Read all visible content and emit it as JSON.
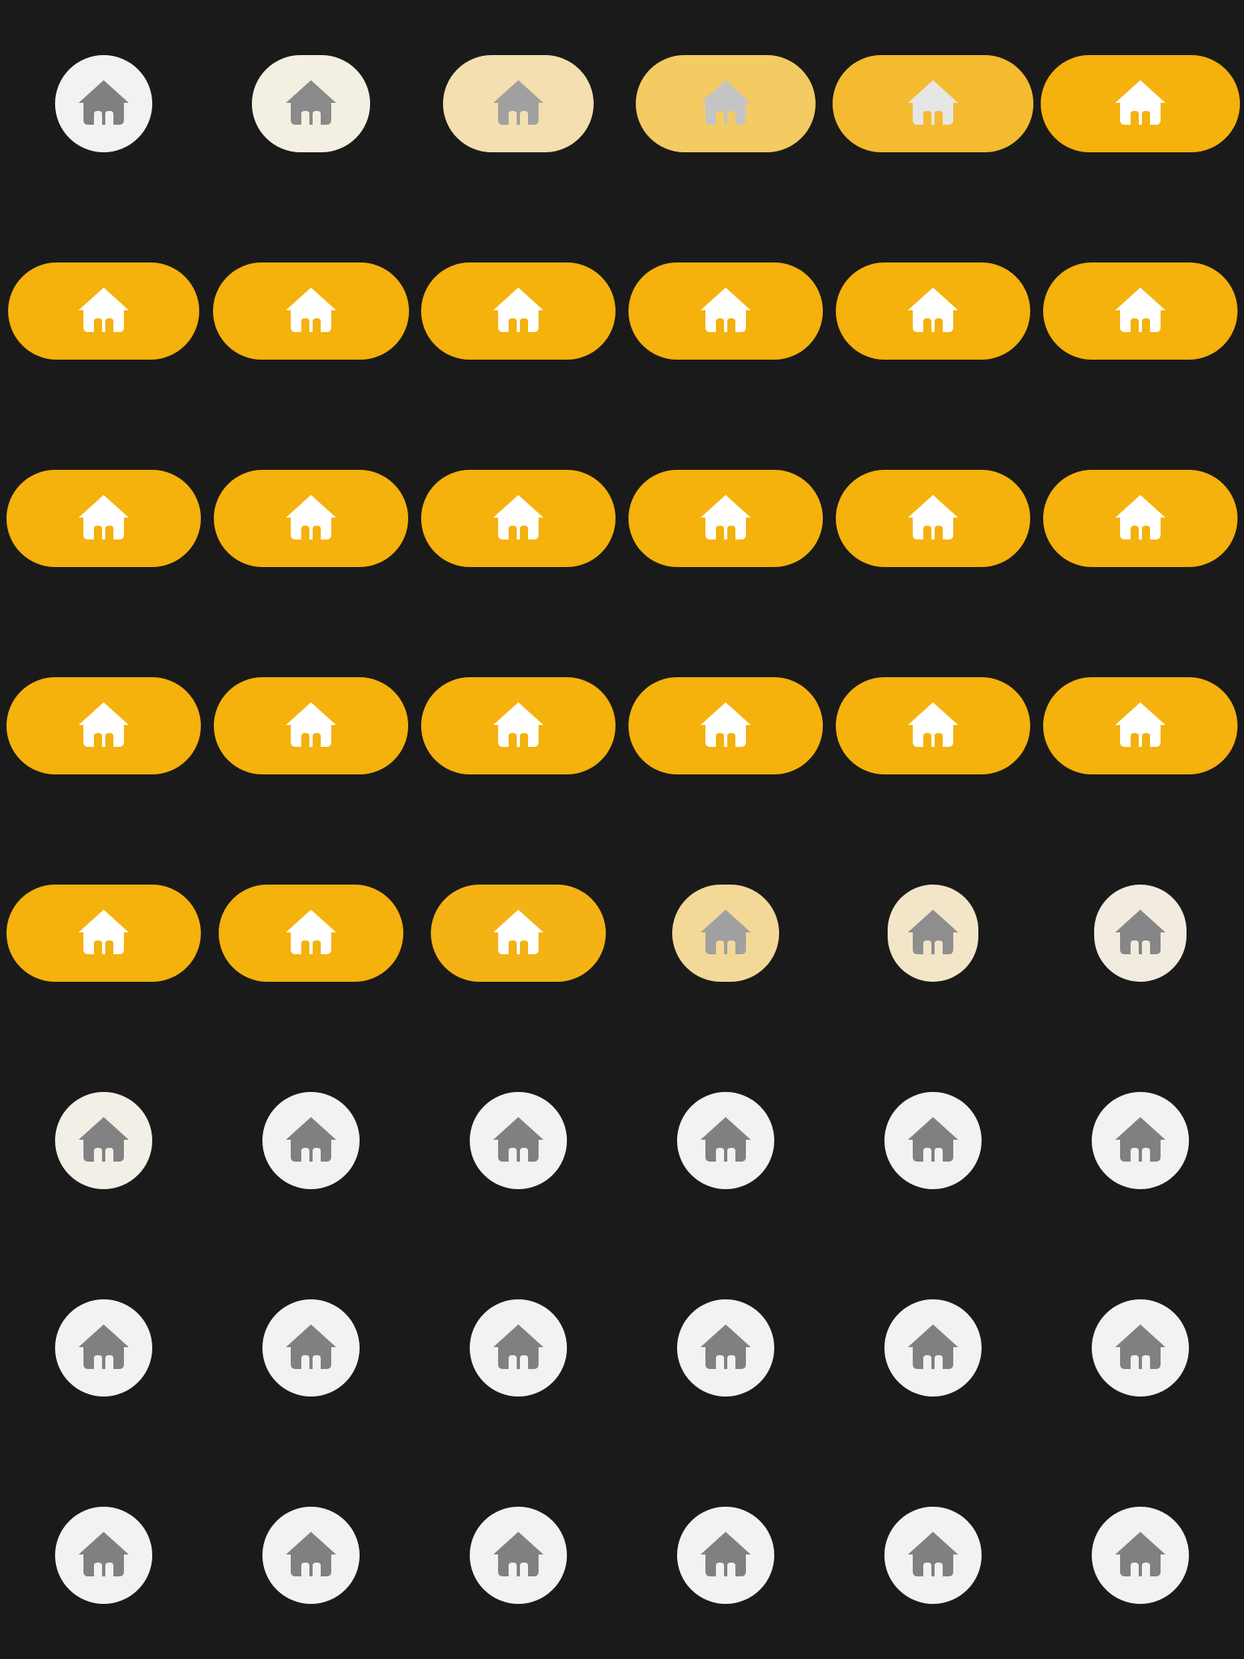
{
  "colors": {
    "background": "#1a1a1a",
    "light": "#f2f2f2",
    "accent": "#f5b10c",
    "icon_on_light": "#808080",
    "icon_on_accent": "#ffffff"
  },
  "icon": "home-icon",
  "rows": [
    [
      {
        "state": "inactive",
        "fill": "#f2f2f2",
        "icon_color": "#808080"
      },
      {
        "state": "transition",
        "fill": "#f3efe3",
        "icon_color": "#8a8a8a"
      },
      {
        "state": "transition",
        "fill": "#f4dfb0",
        "icon_color": "#a0a0a0"
      },
      {
        "state": "transition",
        "fill": "#f4cb63",
        "icon_color": "#c4c4c4"
      },
      {
        "state": "transition",
        "fill": "#f4bb30",
        "icon_color": "#e6e6e6"
      },
      {
        "state": "active",
        "fill": "#f5b10c",
        "icon_color": "#ffffff"
      }
    ],
    [
      {
        "state": "active",
        "fill": "#f5b10c",
        "icon_color": "#ffffff"
      },
      {
        "state": "active",
        "fill": "#f5b10c",
        "icon_color": "#ffffff"
      },
      {
        "state": "active",
        "fill": "#f5b10c",
        "icon_color": "#ffffff"
      },
      {
        "state": "active",
        "fill": "#f5b10c",
        "icon_color": "#ffffff"
      },
      {
        "state": "active",
        "fill": "#f5b10c",
        "icon_color": "#ffffff"
      },
      {
        "state": "active",
        "fill": "#f5b10c",
        "icon_color": "#ffffff"
      }
    ],
    [
      {
        "state": "active",
        "fill": "#f5b10c",
        "icon_color": "#ffffff"
      },
      {
        "state": "active",
        "fill": "#f5b10c",
        "icon_color": "#ffffff"
      },
      {
        "state": "active",
        "fill": "#f5b10c",
        "icon_color": "#ffffff"
      },
      {
        "state": "active",
        "fill": "#f5b10c",
        "icon_color": "#ffffff"
      },
      {
        "state": "active",
        "fill": "#f5b10c",
        "icon_color": "#ffffff"
      },
      {
        "state": "active",
        "fill": "#f5b10c",
        "icon_color": "#ffffff"
      }
    ],
    [
      {
        "state": "active",
        "fill": "#f5b10c",
        "icon_color": "#ffffff"
      },
      {
        "state": "active",
        "fill": "#f5b10c",
        "icon_color": "#ffffff"
      },
      {
        "state": "active",
        "fill": "#f5b10c",
        "icon_color": "#ffffff"
      },
      {
        "state": "active",
        "fill": "#f5b10c",
        "icon_color": "#ffffff"
      },
      {
        "state": "active",
        "fill": "#f5b10c",
        "icon_color": "#ffffff"
      },
      {
        "state": "active",
        "fill": "#f5b10c",
        "icon_color": "#ffffff"
      }
    ],
    [
      {
        "state": "active",
        "fill": "#f5b10c",
        "icon_color": "#ffffff"
      },
      {
        "state": "active",
        "fill": "#f5b10c",
        "icon_color": "#ffffff"
      },
      {
        "state": "active",
        "fill": "#f4b215",
        "icon_color": "#ffffff"
      },
      {
        "state": "transition",
        "fill": "#f4d898",
        "icon_color": "#a0a0a0"
      },
      {
        "state": "transition",
        "fill": "#f3e6c8",
        "icon_color": "#8e8e8e"
      },
      {
        "state": "transition",
        "fill": "#f2ece0",
        "icon_color": "#868686"
      }
    ],
    [
      {
        "state": "inactive",
        "fill": "#f2efe6",
        "icon_color": "#828282"
      },
      {
        "state": "inactive",
        "fill": "#f2f2f2",
        "icon_color": "#808080"
      },
      {
        "state": "inactive",
        "fill": "#f2f2f2",
        "icon_color": "#808080"
      },
      {
        "state": "inactive",
        "fill": "#f2f2f2",
        "icon_color": "#808080"
      },
      {
        "state": "inactive",
        "fill": "#f2f2f2",
        "icon_color": "#808080"
      },
      {
        "state": "inactive",
        "fill": "#f2f2f2",
        "icon_color": "#808080"
      }
    ],
    [
      {
        "state": "inactive",
        "fill": "#f2f2f2",
        "icon_color": "#808080"
      },
      {
        "state": "inactive",
        "fill": "#f2f2f2",
        "icon_color": "#808080"
      },
      {
        "state": "inactive",
        "fill": "#f2f2f2",
        "icon_color": "#808080"
      },
      {
        "state": "inactive",
        "fill": "#f2f2f2",
        "icon_color": "#808080"
      },
      {
        "state": "inactive",
        "fill": "#f2f2f2",
        "icon_color": "#808080"
      },
      {
        "state": "inactive",
        "fill": "#f2f2f2",
        "icon_color": "#808080"
      }
    ],
    [
      {
        "state": "inactive",
        "fill": "#f2f2f2",
        "icon_color": "#808080"
      },
      {
        "state": "inactive",
        "fill": "#f2f2f2",
        "icon_color": "#808080"
      },
      {
        "state": "inactive",
        "fill": "#f2f2f2",
        "icon_color": "#808080"
      },
      {
        "state": "inactive",
        "fill": "#f2f2f2",
        "icon_color": "#808080"
      },
      {
        "state": "inactive",
        "fill": "#f2f2f2",
        "icon_color": "#808080"
      },
      {
        "state": "inactive",
        "fill": "#f2f2f2",
        "icon_color": "#808080"
      }
    ]
  ]
}
